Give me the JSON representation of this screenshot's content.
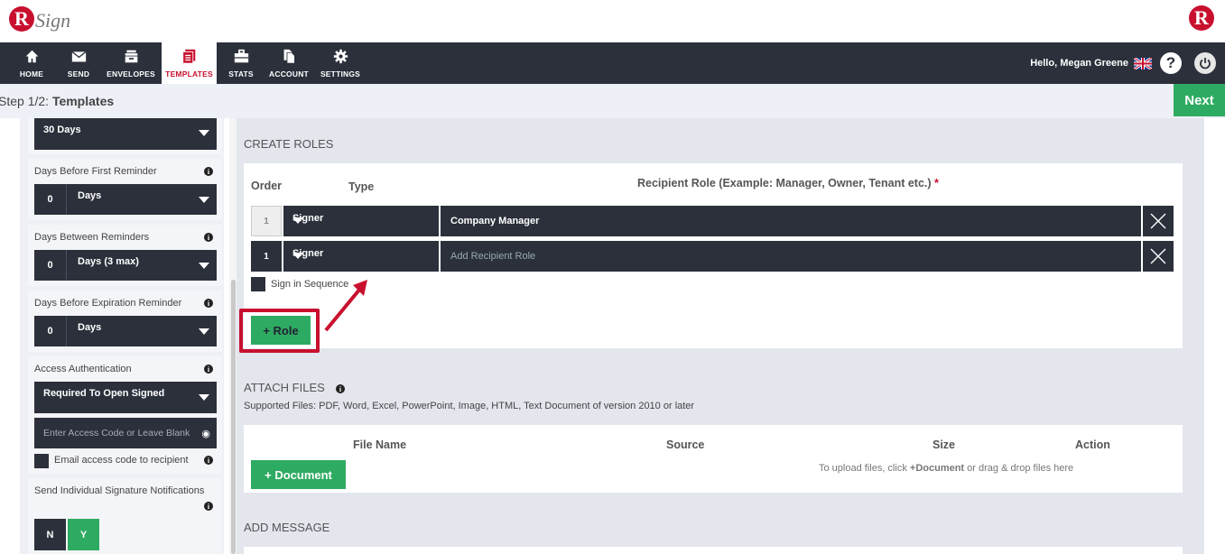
{
  "brand": {
    "logo_letter": "R",
    "logo_text": "Sign",
    "right_letter": "R",
    "accent": "#c8102e"
  },
  "nav": {
    "items": [
      {
        "label": "HOME",
        "icon": "home-icon"
      },
      {
        "label": "SEND",
        "icon": "envelope-icon"
      },
      {
        "label": "ENVELOPES",
        "icon": "inbox-icon"
      },
      {
        "label": "TEMPLATES",
        "icon": "templates-icon",
        "active": true
      },
      {
        "label": "STATS",
        "icon": "briefcase-icon"
      },
      {
        "label": "ACCOUNT",
        "icon": "document-icon"
      },
      {
        "label": "SETTINGS",
        "icon": "gear-icon"
      }
    ],
    "greeting": "Hello, Megan Greene",
    "help": "?"
  },
  "step": {
    "prefix": "Step 1/2:",
    "title": "Templates",
    "next_label": "Next",
    "next_color": "#2eab62"
  },
  "left": {
    "expiry_value": "30 Days",
    "first_reminder": {
      "label": "Days Before First Reminder",
      "num": "0",
      "unit": "Days"
    },
    "between_reminders": {
      "label": "Days Between Reminders",
      "num": "0",
      "unit": "Days (3 max)"
    },
    "expiration_reminder": {
      "label": "Days Before Expiration Reminder",
      "num": "0",
      "unit": "Days"
    },
    "access_auth": {
      "label": "Access Authentication",
      "value": "Required To Open Signed",
      "placeholder": "Enter Access Code or Leave Blank",
      "email_label": "Email access code to recipient"
    },
    "notifications": {
      "label": "Send Individual Signature Notifications",
      "no": "N",
      "yes": "Y"
    }
  },
  "roles": {
    "title": "CREATE ROLES",
    "col_order": "Order",
    "col_type": "Type",
    "col_role": "Recipient Role (Example: Manager, Owner, Tenant etc.)",
    "required_mark": "*",
    "rows": [
      {
        "order": "1",
        "type": "Signer",
        "role": "Company Manager"
      },
      {
        "order": "1",
        "type": "Signer",
        "role": "",
        "placeholder": "Add Recipient Role"
      }
    ],
    "sequence_label": "Sign in Sequence",
    "add_role_label": "+ Role"
  },
  "files": {
    "title": "ATTACH FILES",
    "supported": "Supported Files: PDF, Word, Excel, PowerPoint, Image, HTML, Text Document of version 2010 or later",
    "col_name": "File Name",
    "col_source": "Source",
    "col_size": "Size",
    "col_action": "Action",
    "add_doc_label": "+ Document",
    "hint_pre": "To upload files, click ",
    "hint_bold": "+Document",
    "hint_post": " or drag & drop files here"
  },
  "message": {
    "title": "ADD MESSAGE"
  }
}
